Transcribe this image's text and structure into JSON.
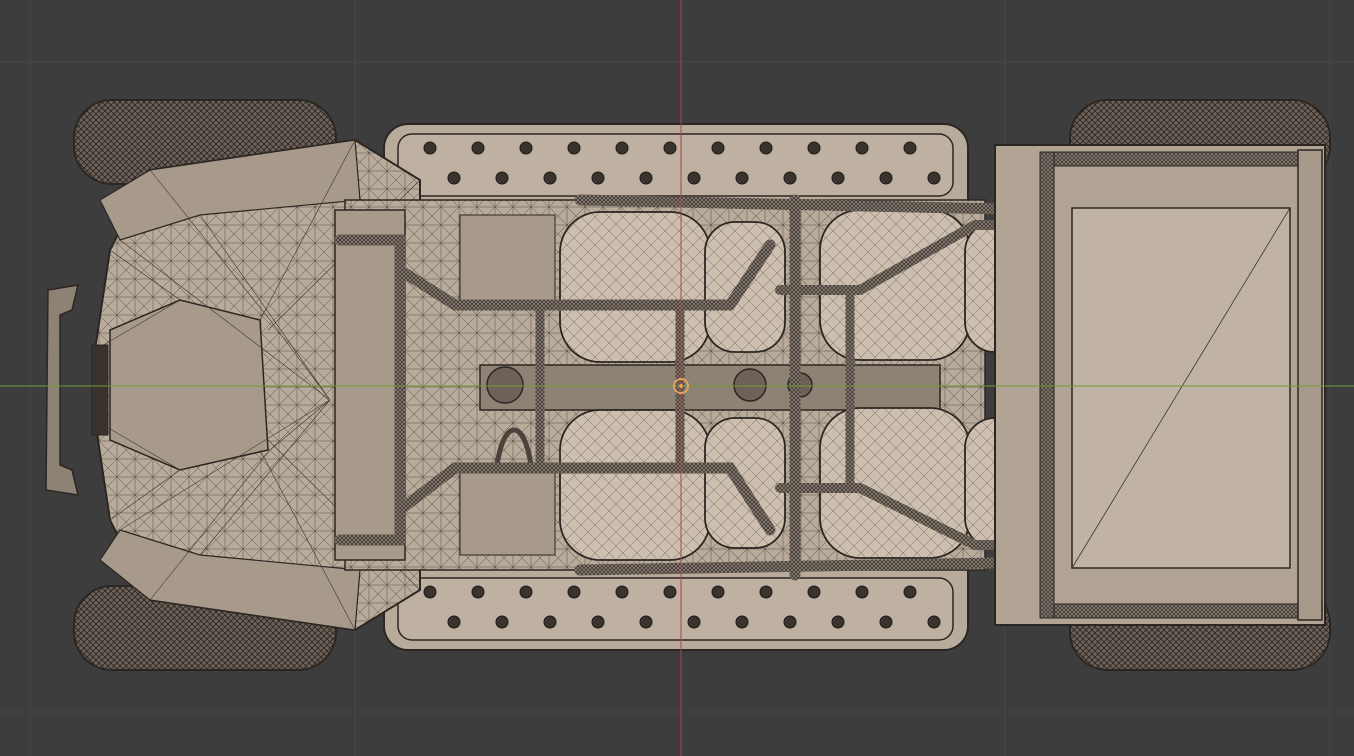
{
  "viewport": {
    "background": "#3d3d3d",
    "grid_color": "#474747",
    "x_axis_color": "#6f9a37",
    "y_axis_color": "#b54046",
    "mesh_fill": "#b9ab9b",
    "mesh_dark": "#8e8274",
    "wire_color": "#2b2622",
    "tire_color": "#6e6258",
    "origin_color": "#e3a35a"
  },
  "scene": {
    "object": "vehicle-mesh",
    "view": "top",
    "shading": "wireframe-overlay"
  }
}
